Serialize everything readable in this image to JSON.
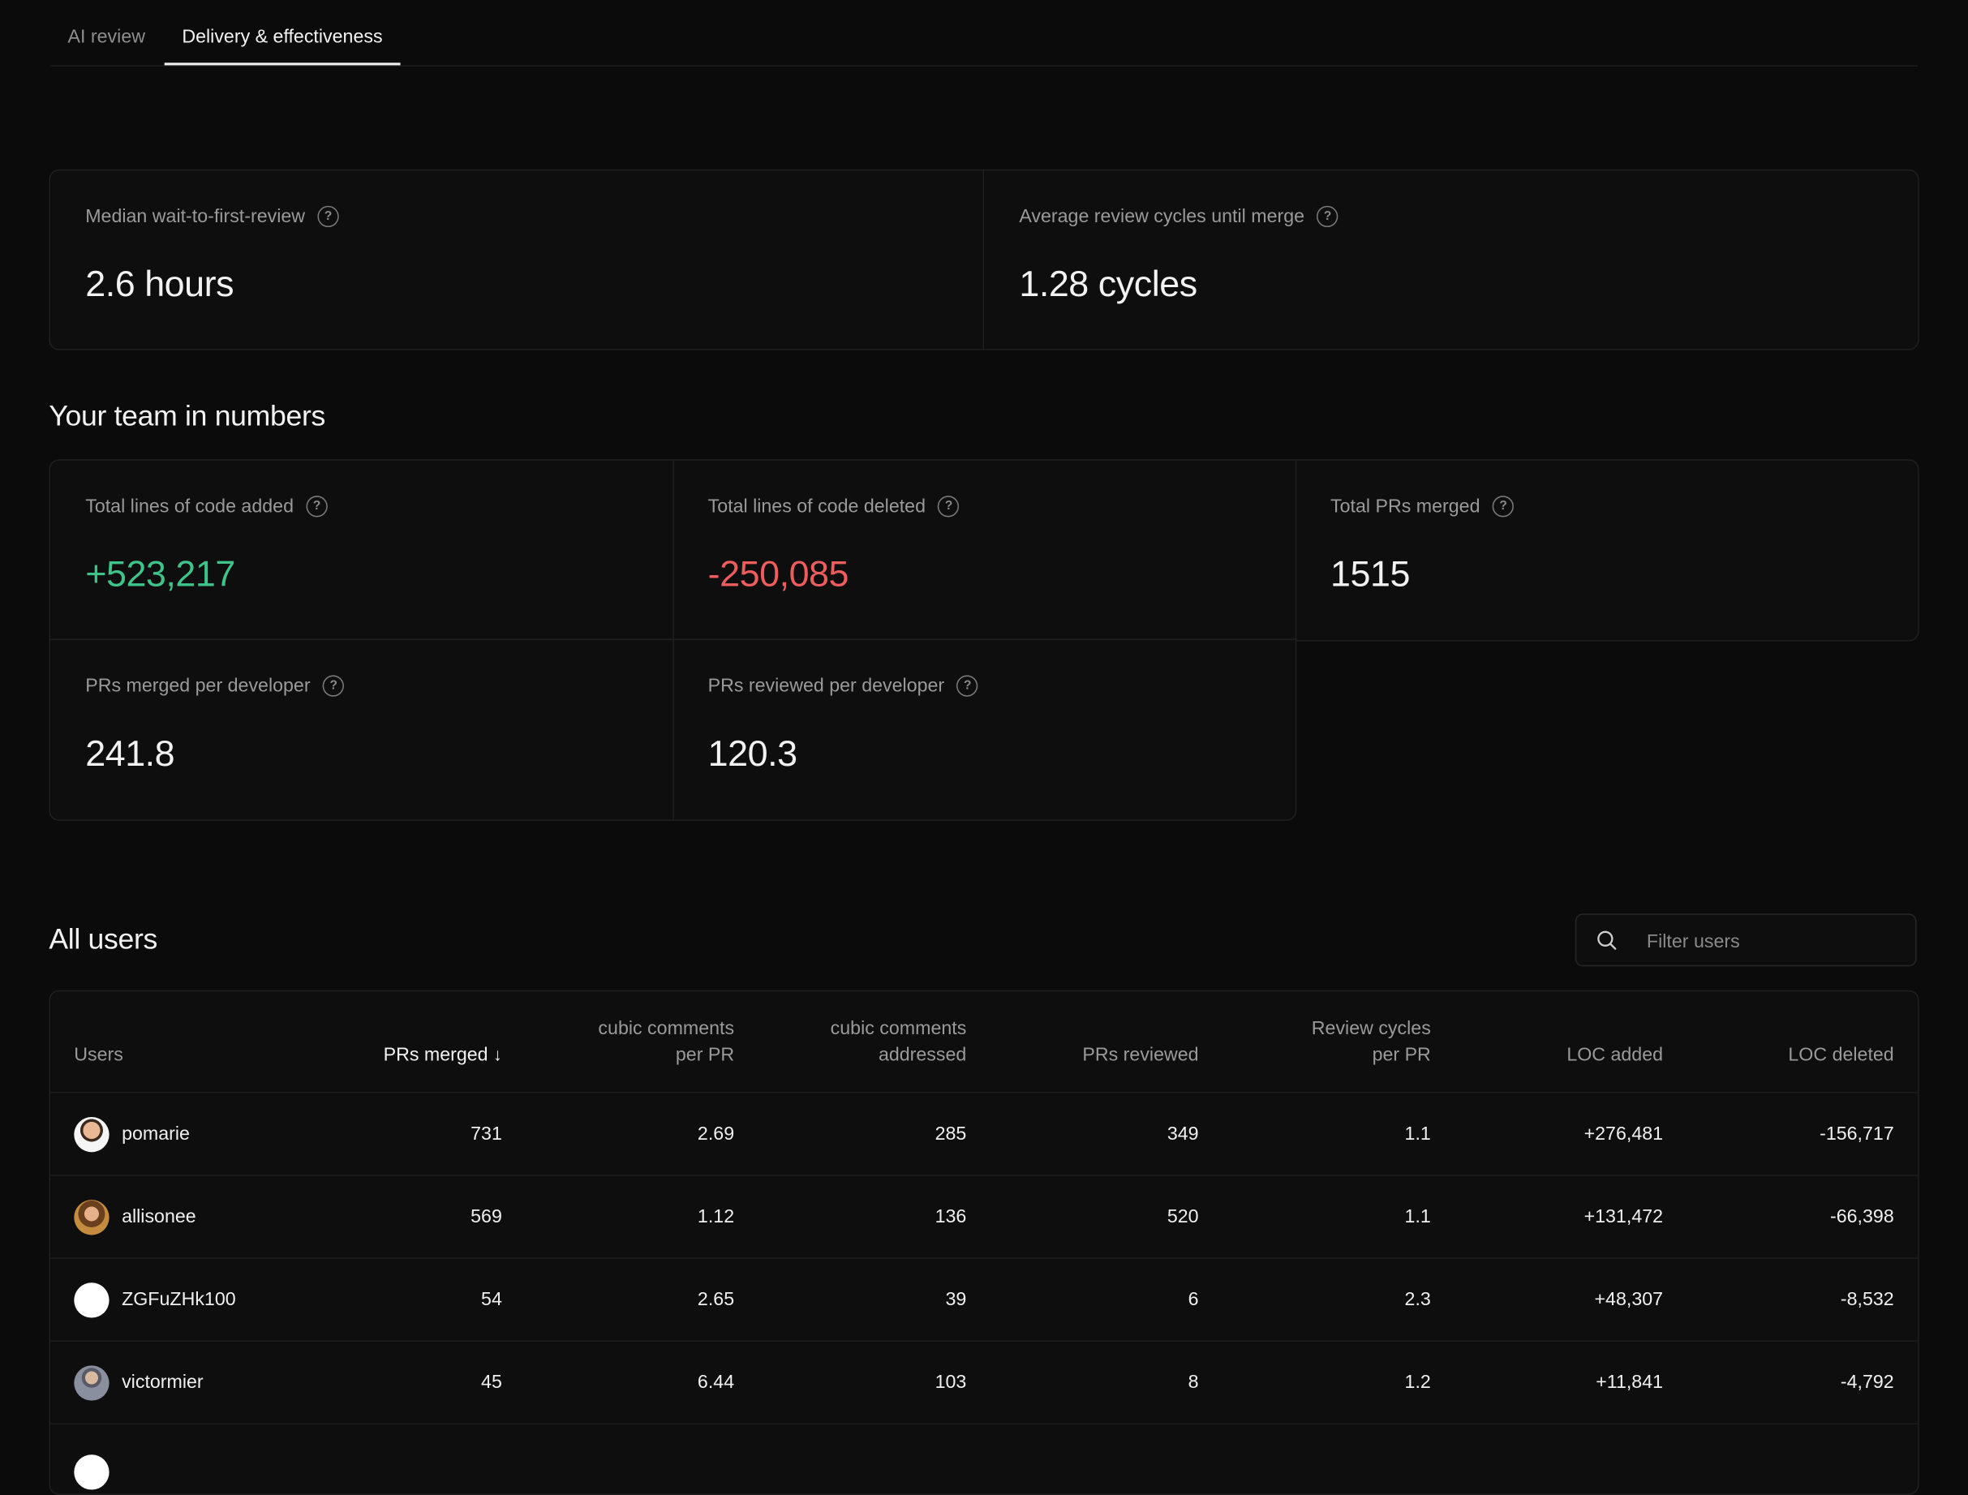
{
  "tabs": [
    {
      "label": "AI review",
      "active": false
    },
    {
      "label": "Delivery & effectiveness",
      "active": true
    }
  ],
  "summary": {
    "wait": {
      "label": "Median wait-to-first-review",
      "value": "2.6 hours"
    },
    "cycles": {
      "label": "Average review cycles until merge",
      "value": "1.28 cycles"
    }
  },
  "team": {
    "title": "Your team in numbers",
    "loc_added": {
      "label": "Total lines of code added",
      "value": "+523,217"
    },
    "loc_deleted": {
      "label": "Total lines of code deleted",
      "value": "-250,085"
    },
    "prs_merged": {
      "label": "Total PRs merged",
      "value": "1515"
    },
    "merged_per_dev": {
      "label": "PRs merged per developer",
      "value": "241.8"
    },
    "reviewed_per_dev": {
      "label": "PRs reviewed per developer",
      "value": "120.3"
    }
  },
  "users_section": {
    "title": "All users",
    "filter_placeholder": "Filter users"
  },
  "table": {
    "headers": {
      "users": "Users",
      "prs_merged": "PRs merged",
      "comments_per_pr_1": "cubic comments",
      "comments_per_pr_2": "per PR",
      "comments_addressed_1": "cubic comments",
      "comments_addressed_2": "addressed",
      "prs_reviewed": "PRs reviewed",
      "review_cycles_1": "Review cycles",
      "review_cycles_2": "per PR",
      "loc_added": "LOC added",
      "loc_deleted": "LOC deleted"
    },
    "sort_indicator": "↓",
    "rows": [
      {
        "user": "pomarie",
        "prs_merged": "731",
        "comments_per_pr": "2.69",
        "comments_addressed": "285",
        "prs_reviewed": "349",
        "review_cycles": "1.1",
        "loc_added": "+276,481",
        "loc_deleted": "-156,717"
      },
      {
        "user": "allisonee",
        "prs_merged": "569",
        "comments_per_pr": "1.12",
        "comments_addressed": "136",
        "prs_reviewed": "520",
        "review_cycles": "1.1",
        "loc_added": "+131,472",
        "loc_deleted": "-66,398"
      },
      {
        "user": "ZGFuZHk100",
        "prs_merged": "54",
        "comments_per_pr": "2.65",
        "comments_addressed": "39",
        "prs_reviewed": "6",
        "review_cycles": "2.3",
        "loc_added": "+48,307",
        "loc_deleted": "-8,532"
      },
      {
        "user": "victormier",
        "prs_merged": "45",
        "comments_per_pr": "6.44",
        "comments_addressed": "103",
        "prs_reviewed": "8",
        "review_cycles": "1.2",
        "loc_added": "+11,841",
        "loc_deleted": "-4,792"
      }
    ]
  },
  "colors": {
    "background": "#0b0b0b",
    "positive": "#3ec489",
    "negative": "#ee5d5d",
    "muted_text": "#9a9a9a"
  },
  "icons": {
    "help": "question-circle-icon",
    "search": "search-icon",
    "sort": "arrow-down-icon"
  }
}
